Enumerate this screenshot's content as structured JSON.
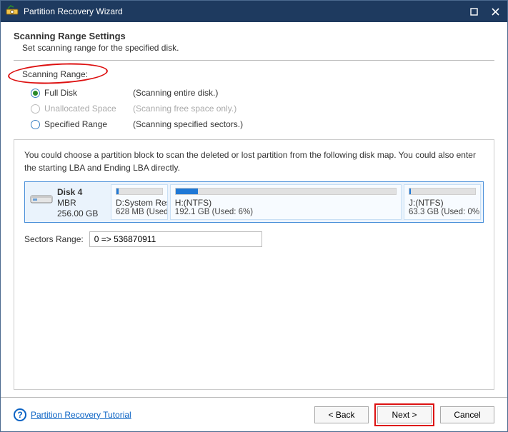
{
  "titlebar": {
    "title": "Partition Recovery Wizard"
  },
  "header": {
    "heading": "Scanning Range Settings",
    "sub": "Set scanning range for the specified disk."
  },
  "section_label": "Scanning Range:",
  "radios": {
    "full": {
      "label": "Full Disk",
      "desc": "(Scanning entire disk.)",
      "selected": true,
      "enabled": true
    },
    "unalloc": {
      "label": "Unallocated Space",
      "desc": "(Scanning free space only.)",
      "selected": false,
      "enabled": false
    },
    "range": {
      "label": "Specified Range",
      "desc": "(Scanning specified sectors.)",
      "selected": false,
      "enabled": true
    }
  },
  "panel": {
    "text": "You could choose a partition block to scan the deleted or lost partition from the following disk map. You could also enter the starting LBA and Ending LBA directly.",
    "disk": {
      "name": "Disk 4",
      "scheme": "MBR",
      "size": "256.00 GB"
    },
    "parts": [
      {
        "label": "D:System Res",
        "sub": "628 MB (Used",
        "fill_pct": 4,
        "flex": 14
      },
      {
        "label": "H:(NTFS)",
        "sub": "192.1 GB (Used: 6%)",
        "fill_pct": 10,
        "flex": 66
      },
      {
        "label": "J:(NTFS)",
        "sub": "63.3 GB (Used: 0%",
        "fill_pct": 2,
        "flex": 20
      }
    ],
    "sectors_label": "Sectors Range:",
    "sectors_value": "0 => 536870911"
  },
  "footer": {
    "tutorial": "Partition Recovery Tutorial",
    "back": "< Back",
    "next": "Next >",
    "cancel": "Cancel"
  }
}
